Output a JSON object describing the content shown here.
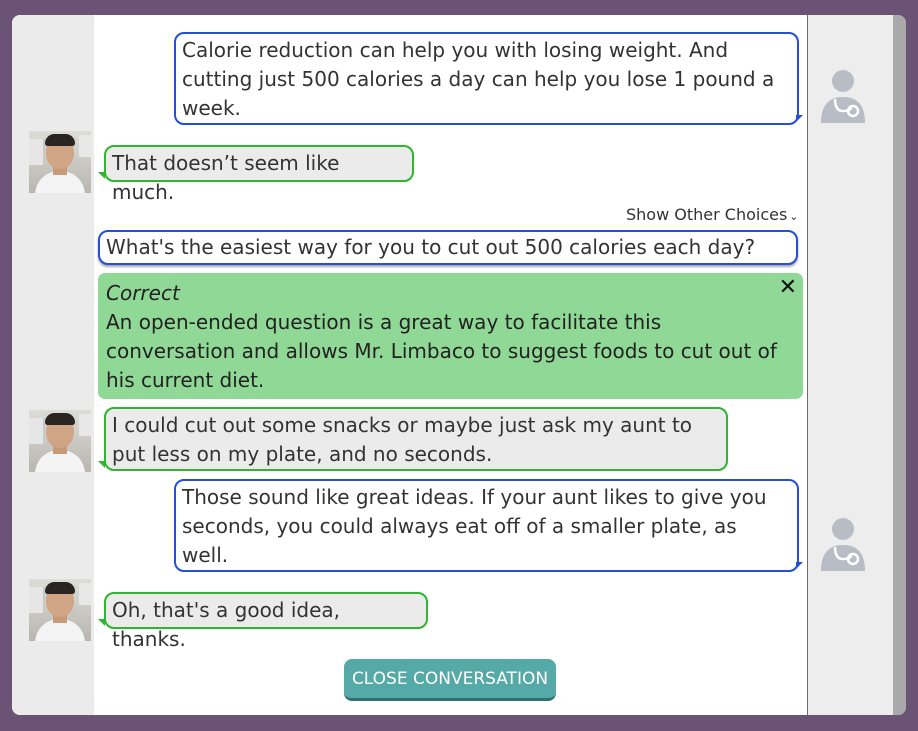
{
  "messages": [
    {
      "speaker": "doctor",
      "text": "Calorie reduction can help you with losing weight. And cutting just 500 calories a day can help you lose 1 pound a week."
    },
    {
      "speaker": "patient",
      "text": "That doesn’t seem like much."
    },
    {
      "speaker": "doctor-choice",
      "text": "What's the easiest way for you to cut out 500 calories each day?"
    },
    {
      "speaker": "patient",
      "text": "I could cut out some snacks or maybe just ask my aunt to put less on my plate, and no seconds."
    },
    {
      "speaker": "doctor",
      "text": "Those sound like great ideas. If your aunt likes to give you seconds, you could always eat off of a smaller plate, as well."
    },
    {
      "speaker": "patient",
      "text": "Oh, that's a good idea, thanks."
    }
  ],
  "show_other_choices": {
    "label": "Show Other Choices",
    "icon": "chevron-down-icon"
  },
  "feedback": {
    "title": "Correct",
    "body": "An open-ended question is a great way to facilitate this conversation and allows Mr. Limbaco to suggest foods to cut out of his current diet.",
    "close_symbol": "✕"
  },
  "close_conversation_label": "CLOSE CONVERSATION",
  "colors": {
    "background": "#6b5375",
    "doctor_border": "#2350d6",
    "patient_border": "#2fb52f",
    "feedback_bg": "#90d895",
    "button": "#55a9a6"
  }
}
